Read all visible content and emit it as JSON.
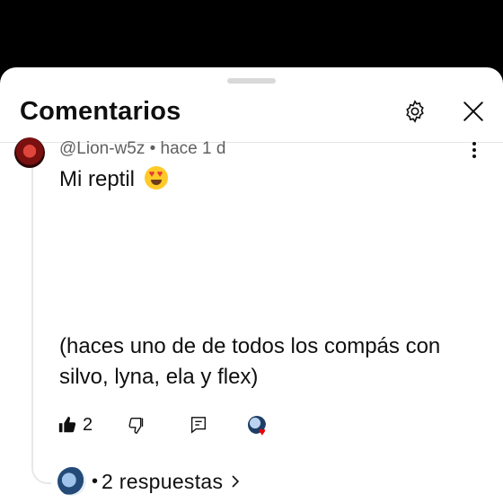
{
  "header": {
    "title": "Comentarios"
  },
  "comment": {
    "author": "@Lion-w5z",
    "separator": "•",
    "time": "hace 1 d",
    "text_line1": "Mi reptil",
    "text_body": "(haces uno de de todos los compás con silvo, lyna, ela y flex)",
    "likes": "2"
  },
  "replies": {
    "separator": "•",
    "label": "2 respuestas"
  },
  "icons": {
    "settings": "gear-icon",
    "close": "close-icon",
    "more": "more-vert-icon",
    "like": "thumbs-up-filled-icon",
    "dislike": "thumbs-down-icon",
    "reply": "reply-icon",
    "creator_heart": "creator-heart-icon",
    "chevron": "chevron-right-icon"
  },
  "colors": {
    "sheet": "#ffffff",
    "background": "#000000",
    "text": "#0f0f0f",
    "meta": "#606060",
    "heart": "#e00000"
  }
}
